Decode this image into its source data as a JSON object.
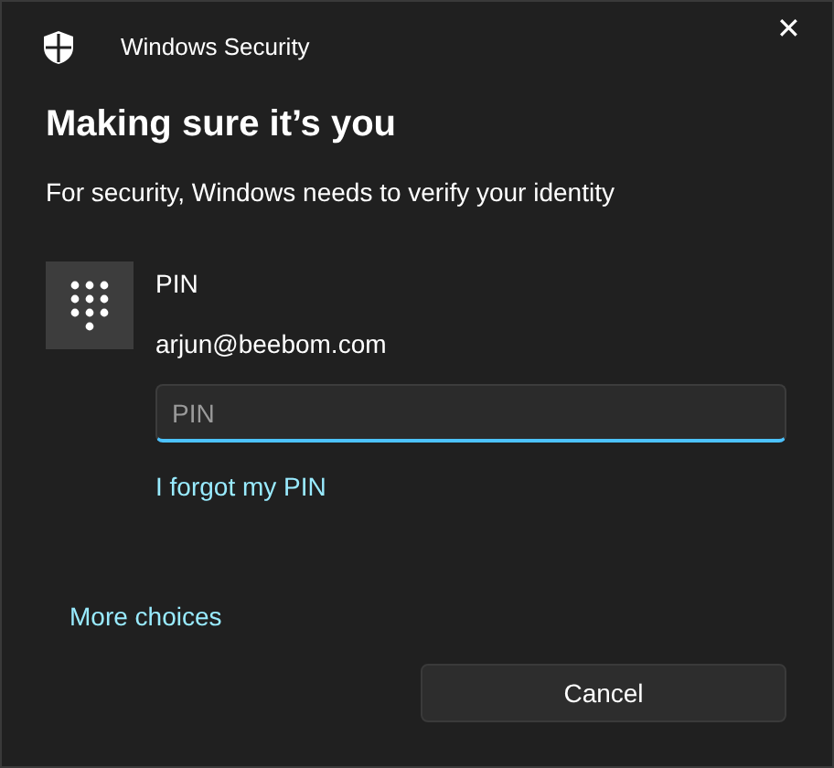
{
  "window": {
    "title": "Windows Security",
    "close": "✕"
  },
  "heading": "Making sure it’s you",
  "subtitle": "For security, Windows needs to verify your identity",
  "credential": {
    "method": "PIN",
    "account": "arjun@beebom.com"
  },
  "pin_field": {
    "placeholder": "PIN"
  },
  "forgot_link": "I forgot my PIN",
  "more_choices": "More choices",
  "buttons": [
    "Cancel"
  ]
}
